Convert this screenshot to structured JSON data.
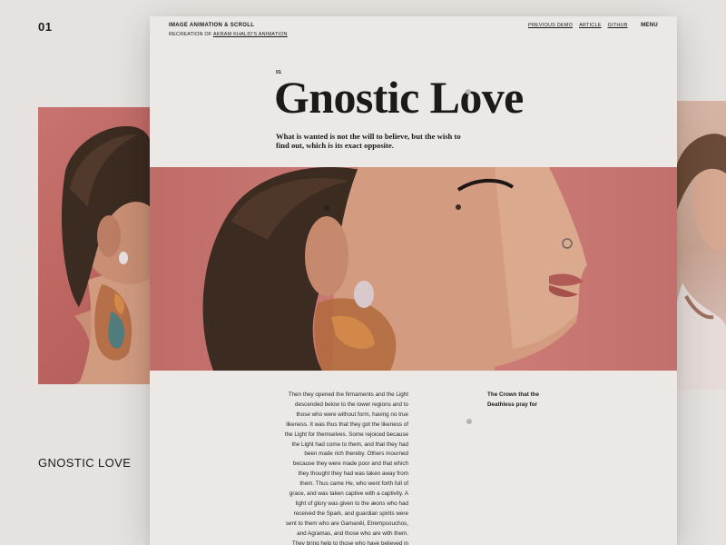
{
  "background": {
    "index": "01",
    "title": "GNOSTIC LOVE"
  },
  "header": {
    "brand_title": "IMAGE ANIMATION & SCROLL",
    "brand_sub_prefix": "RECREATION OF ",
    "brand_sub_link": "AKRAM KHALID'S ANIMATION",
    "nav": [
      "PREVIOUS DEMO",
      "ARTICLE",
      "GITHUB"
    ],
    "menu": "MENU"
  },
  "hero": {
    "number": "01",
    "title": "Gnostic Love",
    "quote": "What is wanted is not the will to believe, but the wish to find out, which is its exact opposite."
  },
  "article": {
    "body": "Then they opened the firmaments and the Light descended below to the lower regions and to those who were without form, having no true likeness. It was thus that they got the likeness of the Light for themselves. Some rejoiced because the Light had come to them, and that they had been made rich thereby. Others mourned because they were made poor and that which they thought they had was taken away from them. Thus came He, who went forth full of grace, and was taken captive with a captivity. A light of glory was given to the æons who had received the Spark, and guardian spirits were sent to them who are Gamanêl, Etrempsouchos, and Agramas, and those who are with them. They bring help to those who have believed in the Spark of Light.",
    "sidenote": "The Crown that the Deathless pray for"
  },
  "icons": [
    "menu-icon"
  ],
  "colors": {
    "page_bg": "#e6e2df",
    "card_bg": "#ebe8e5",
    "photo_backdrop": "#c97874",
    "text": "#1b1a18"
  }
}
